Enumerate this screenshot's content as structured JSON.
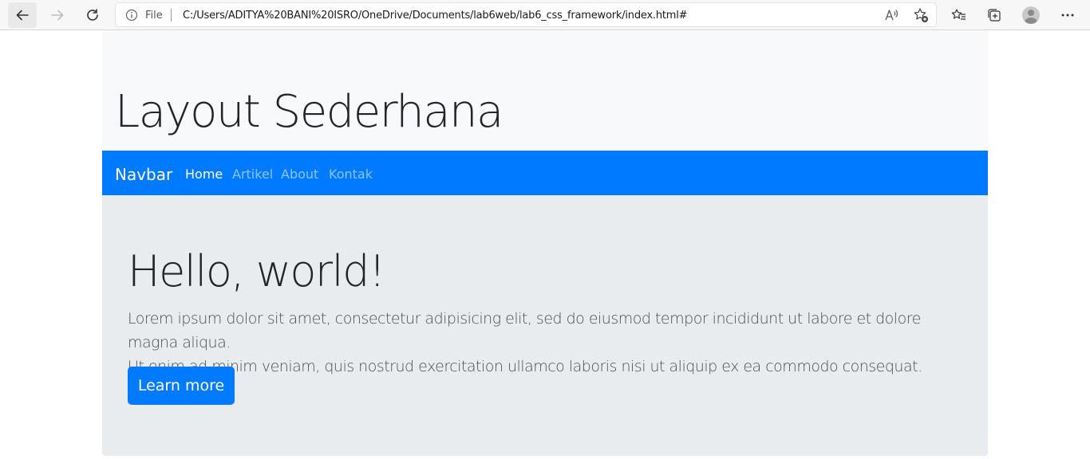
{
  "browser": {
    "address": {
      "scheme_label": "File",
      "url": "C:/Users/ADITYA%20BANI%20ISRO/OneDrive/Documents/lab6web/lab6_css_framework/index.html#"
    },
    "icons": {
      "back": "back-arrow-icon",
      "forward": "forward-arrow-icon",
      "reload": "reload-icon",
      "info": "info-icon",
      "read_aloud": "read-aloud-icon",
      "add_favorite": "add-favorite-icon",
      "favorites": "favorites-icon",
      "collections": "collections-icon",
      "profile": "profile-avatar",
      "more": "more-icon"
    }
  },
  "page": {
    "header_title": "Layout Sederhana",
    "navbar": {
      "brand": "Navbar",
      "links": [
        {
          "label": "Home",
          "active": true
        },
        {
          "label": "Artikel",
          "active": false
        },
        {
          "label": "About",
          "active": false
        },
        {
          "label": "Kontak",
          "active": false
        }
      ]
    },
    "jumbotron": {
      "heading": "Hello, world!",
      "lead_line1": "Lorem ipsum dolor sit amet, consectetur adipisicing elit, sed do eiusmod tempor incididunt ut labore et dolore magna aliqua.",
      "lead_line2": "Ut enim ad minim veniam, quis nostrud exercitation ullamco laboris nisi ut aliquip ex ea commodo consequat.",
      "button_label": "Learn more"
    }
  },
  "colors": {
    "primary": "#007bff",
    "header_bg": "#f8f9fa",
    "jumbotron_bg": "#e9ecef"
  }
}
